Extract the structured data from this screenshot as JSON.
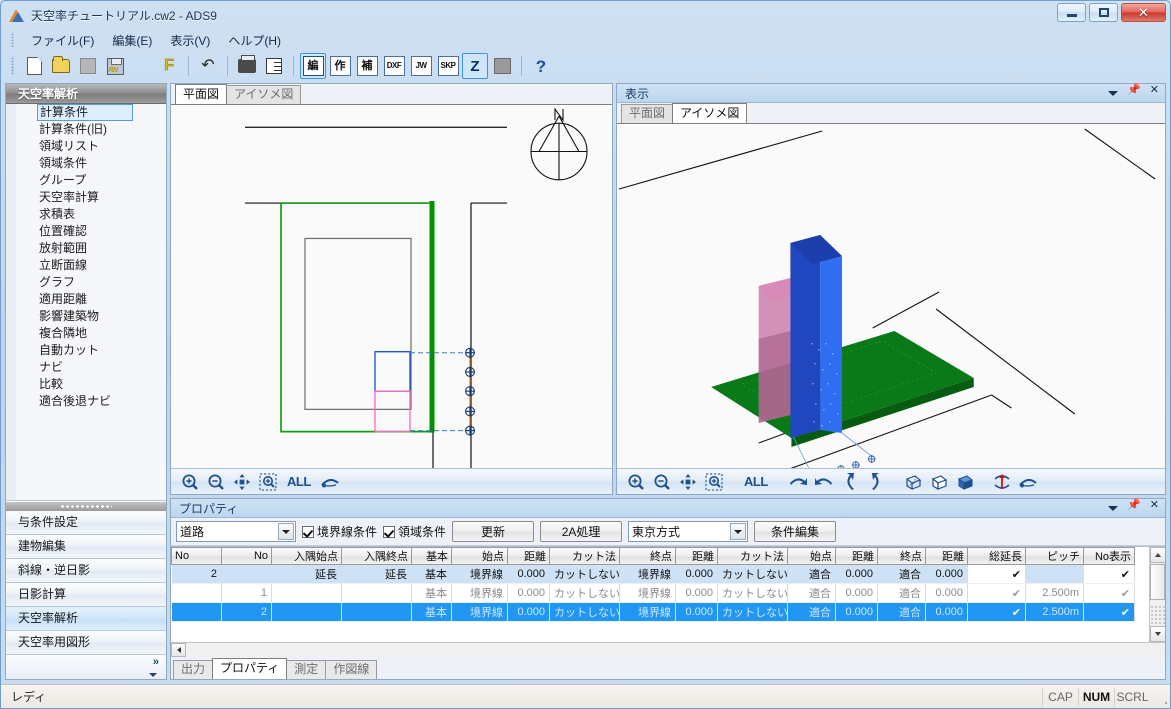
{
  "window": {
    "title": "天空率チュートリアル.cw2 - ADS9",
    "app_icon": "ads-triangle-icon",
    "minimize_label": "",
    "maximize_label": "",
    "close_label": "✕"
  },
  "menubar": {
    "items": [
      {
        "label": "ファイル(F)"
      },
      {
        "label": "編集(E)"
      },
      {
        "label": "表示(V)"
      },
      {
        "label": "ヘルプ(H)"
      }
    ]
  },
  "toolbar": {
    "buttons": [
      {
        "name": "new-icon",
        "type": "icon",
        "label": ""
      },
      {
        "name": "open-icon",
        "type": "icon",
        "label": ""
      },
      {
        "name": "stop-icon",
        "type": "icon",
        "label": ""
      },
      {
        "name": "save-rn-icon",
        "type": "icon",
        "label": "RN"
      },
      {
        "name": "info-icon",
        "type": "icon",
        "label": ""
      },
      {
        "name": "font-f-icon",
        "type": "icon",
        "label": "F"
      },
      {
        "name": "undo-icon",
        "type": "icon",
        "label": "↶"
      },
      {
        "name": "print-icon",
        "type": "icon",
        "label": ""
      },
      {
        "name": "print-setup-icon",
        "type": "icon",
        "label": ""
      },
      {
        "name": "mode-edit-button",
        "type": "box",
        "label": "編",
        "active": true
      },
      {
        "name": "mode-create-button",
        "type": "box",
        "label": "作",
        "active": false
      },
      {
        "name": "mode-assist-button",
        "type": "box",
        "label": "補",
        "active": false
      },
      {
        "name": "export-dxf-button",
        "type": "box",
        "label": "DXF",
        "active": false
      },
      {
        "name": "export-jw-button",
        "type": "box",
        "label": "JW",
        "active": false
      },
      {
        "name": "export-skp-button",
        "type": "box",
        "label": "SKP",
        "active": false
      },
      {
        "name": "mode-z-button",
        "type": "bigbox",
        "label": "Z",
        "active": true
      },
      {
        "name": "book-icon",
        "type": "icon",
        "label": ""
      },
      {
        "name": "help-icon",
        "type": "icon",
        "label": "?"
      }
    ]
  },
  "sidebar": {
    "header": "天空率解析",
    "tree_items": [
      {
        "label": "計算条件",
        "selected": true
      },
      {
        "label": "計算条件(旧)",
        "selected": false
      },
      {
        "label": "領域リスト",
        "selected": false
      },
      {
        "label": "領域条件",
        "selected": false
      },
      {
        "label": "グループ",
        "selected": false
      },
      {
        "label": "天空率計算",
        "selected": false
      },
      {
        "label": "求積表",
        "selected": false
      },
      {
        "label": "位置確認",
        "selected": false
      },
      {
        "label": "放射範囲",
        "selected": false
      },
      {
        "label": "立断面線",
        "selected": false
      },
      {
        "label": "グラフ",
        "selected": false
      },
      {
        "label": "適用距離",
        "selected": false
      },
      {
        "label": "影響建築物",
        "selected": false
      },
      {
        "label": "複合隣地",
        "selected": false
      },
      {
        "label": "自動カット",
        "selected": false
      },
      {
        "label": "ナビ",
        "selected": false
      },
      {
        "label": "比較",
        "selected": false
      },
      {
        "label": "適合後退ナビ",
        "selected": false
      }
    ],
    "category_buttons": [
      {
        "label": "与条件設定",
        "active": false
      },
      {
        "label": "建物編集",
        "active": false
      },
      {
        "label": "斜線・逆日影",
        "active": false
      },
      {
        "label": "日影計算",
        "active": false
      },
      {
        "label": "天空率解析",
        "active": true
      },
      {
        "label": "天空率用図形",
        "active": false
      }
    ],
    "overflow_label": "»"
  },
  "plan_view": {
    "tabs": [
      {
        "label": "平面図",
        "active": true
      },
      {
        "label": "アイソメ図",
        "active": false
      }
    ],
    "toolbar": [
      {
        "name": "zoom-in-icon",
        "label": ""
      },
      {
        "name": "zoom-out-icon",
        "label": ""
      },
      {
        "name": "pan-icon",
        "label": ""
      },
      {
        "name": "zoom-window-icon",
        "label": ""
      },
      {
        "name": "zoom-all-button",
        "label": "ALL"
      },
      {
        "name": "eye-view-icon",
        "label": ""
      }
    ]
  },
  "iso_view": {
    "panel_title": "表示",
    "tabs": [
      {
        "label": "平面図",
        "active": false
      },
      {
        "label": "アイソメ図",
        "active": true
      }
    ],
    "toolbar": [
      {
        "name": "zoom-in-icon",
        "label": ""
      },
      {
        "name": "zoom-out-icon",
        "label": ""
      },
      {
        "name": "pan-icon",
        "label": ""
      },
      {
        "name": "zoom-window-icon",
        "label": ""
      },
      {
        "name": "zoom-all-button",
        "label": "ALL"
      },
      {
        "name": "rotate-right-icon",
        "label": ""
      },
      {
        "name": "rotate-left-icon",
        "label": ""
      },
      {
        "name": "rotate-up-icon",
        "label": ""
      },
      {
        "name": "rotate-down-icon",
        "label": ""
      },
      {
        "name": "wireframe-box-icon",
        "label": ""
      },
      {
        "name": "hidden-line-box-icon",
        "label": ""
      },
      {
        "name": "shaded-box-icon",
        "label": ""
      },
      {
        "name": "axis-rotate-icon",
        "label": ""
      },
      {
        "name": "eye-view-icon",
        "label": ""
      }
    ],
    "panel_controls": [
      {
        "name": "panel-dropdown-icon"
      },
      {
        "name": "panel-pin-icon"
      },
      {
        "name": "panel-close-icon"
      }
    ]
  },
  "property_panel": {
    "title": "プロパティ",
    "panel_controls": [
      {
        "name": "panel-dropdown-icon"
      },
      {
        "name": "panel-pin-icon"
      },
      {
        "name": "panel-close-icon"
      }
    ],
    "toolbar": {
      "type_select": {
        "value": "道路",
        "name": "boundary-type-select"
      },
      "checkbox_boundary": {
        "label": "境界線条件",
        "checked": true
      },
      "checkbox_region": {
        "label": "領域条件",
        "checked": true
      },
      "update_button": "更新",
      "process_2a_button": "2A処理",
      "method_select": {
        "value": "東京方式",
        "name": "calc-method-select"
      },
      "edit_condition_button": "条件編集"
    },
    "grid": {
      "columns": [
        "No",
        "No",
        "入隅始点",
        "入隅終点",
        "基本",
        "始点",
        "距離",
        "カット法",
        "終点",
        "距離",
        "カット法",
        "始点",
        "距離",
        "終点",
        "距離",
        "総延長",
        "ピッチ",
        "No表示"
      ],
      "rows": [
        {
          "style": "head",
          "cells": [
            "2",
            "",
            "延長",
            "延長",
            "基本",
            "境界線",
            "0.000",
            "カットしない",
            "境界線",
            "0.000",
            "カットしない",
            "適合",
            "0.000",
            "適合",
            "0.000",
            "✔",
            "",
            "✔"
          ]
        },
        {
          "style": "sub",
          "cells": [
            "",
            "1",
            "",
            "",
            "基本",
            "境界線",
            "0.000",
            "カットしない",
            "境界線",
            "0.000",
            "カットしない",
            "適合",
            "0.000",
            "適合",
            "0.000",
            "✔",
            "2.500m",
            "✔"
          ]
        },
        {
          "style": "selected",
          "cells": [
            "",
            "2",
            "",
            "",
            "基本",
            "境界線",
            "0.000",
            "カットしない",
            "境界線",
            "0.000",
            "カットしない",
            "適合",
            "0.000",
            "適合",
            "0.000",
            "✔",
            "2.500m",
            "✔"
          ]
        }
      ]
    },
    "bottom_tabs": [
      {
        "label": "出力",
        "active": false
      },
      {
        "label": "プロパティ",
        "active": true
      },
      {
        "label": "測定",
        "active": false
      },
      {
        "label": "作図線",
        "active": false
      }
    ]
  },
  "statusbar": {
    "message": "レディ",
    "indicators": [
      {
        "label": "CAP",
        "on": false
      },
      {
        "label": "NUM",
        "on": true
      },
      {
        "label": "SCRL",
        "on": false
      }
    ]
  },
  "colors": {
    "accent_blue": "#2196f3",
    "site_green": "#00a000",
    "building_blue": "#2050d0",
    "building_pink": "#e878b8",
    "ground_green": "#0a7a18",
    "selection_blue": "#2196f3"
  }
}
